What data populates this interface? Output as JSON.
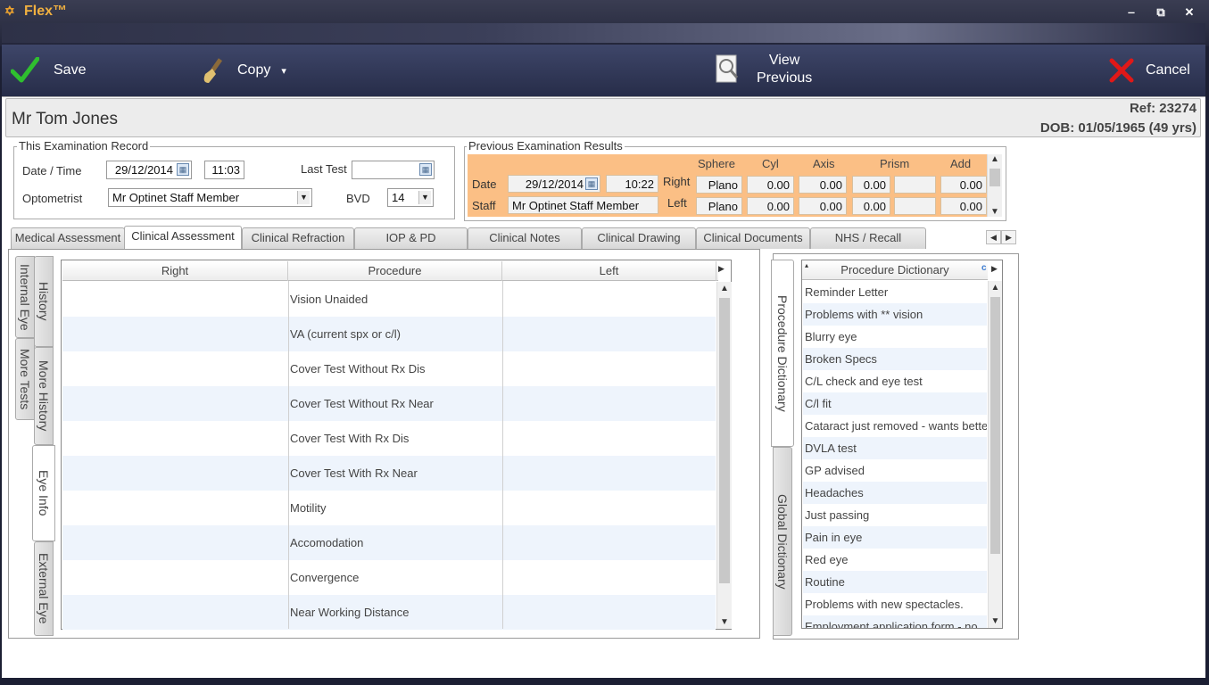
{
  "app": {
    "title": "Flex™",
    "logo": "✡"
  },
  "window": {
    "minimize": "‒",
    "restore": "⧉",
    "close": "✕"
  },
  "toolbar": {
    "save_label": "Save",
    "copy_label": "Copy",
    "copy_arrow": "▾",
    "view_previous_line1": "View",
    "view_previous_line2": "Previous",
    "cancel_label": "Cancel"
  },
  "patient": {
    "name": "Mr Tom Jones",
    "ref": "Ref: 23274",
    "dob": "DOB: 01/05/1965 (49 yrs)"
  },
  "exam": {
    "legend": "This Examination Record",
    "date_time_label": "Date / Time",
    "date": "29/12/2014",
    "time": "11:03",
    "last_test_label": "Last Test",
    "last_test_value": "",
    "optometrist_label": "Optometrist",
    "optometrist_value": "Mr Optinet Staff Member",
    "bvd_label": "BVD",
    "bvd_value": "14"
  },
  "previous": {
    "legend": "Previous Examination Results",
    "headers": {
      "sphere": "Sphere",
      "cyl": "Cyl",
      "axis": "Axis",
      "prism": "Prism",
      "add": "Add"
    },
    "date_label": "Date",
    "date": "29/12/2014",
    "time": "10:22",
    "staff_label": "Staff",
    "staff": "Mr Optinet Staff Member",
    "right_label": "Right",
    "left_label": "Left",
    "right": {
      "sphere": "Plano",
      "cyl": "0.00",
      "axis": "0.00",
      "prism": "0.00",
      "prism2": "",
      "add": "0.00"
    },
    "left": {
      "sphere": "Plano",
      "cyl": "0.00",
      "axis": "0.00",
      "prism": "0.00",
      "prism2": "",
      "add": "0.00"
    }
  },
  "tabs": [
    "Medical Assessment",
    "Clinical Assessment",
    "Clinical Refraction",
    "IOP & PD",
    "Clinical Notes",
    "Clinical Drawing",
    "Clinical Documents",
    "NHS / Recall"
  ],
  "vertical_tabs": {
    "internal_eye": "Internal Eye",
    "history": "History",
    "more_tests": "More Tests",
    "more_history": "More History",
    "eye_info": "Eye Info",
    "external_eye": "External Eye"
  },
  "grid": {
    "headers": {
      "right": "Right",
      "procedure": "Procedure",
      "left": "Left"
    },
    "rows": [
      {
        "right": "",
        "procedure": "Vision Unaided",
        "left": ""
      },
      {
        "right": "",
        "procedure": "VA (current spx or c/l)",
        "left": ""
      },
      {
        "right": "",
        "procedure": "Cover Test Without Rx Dis",
        "left": ""
      },
      {
        "right": "",
        "procedure": "Cover Test Without Rx Near",
        "left": ""
      },
      {
        "right": "",
        "procedure": "Cover Test With Rx Dis",
        "left": ""
      },
      {
        "right": "",
        "procedure": "Cover Test With Rx Near",
        "left": ""
      },
      {
        "right": "",
        "procedure": "Motility",
        "left": ""
      },
      {
        "right": "",
        "procedure": "Accomodation",
        "left": ""
      },
      {
        "right": "",
        "procedure": "Convergence",
        "left": ""
      },
      {
        "right": "",
        "procedure": "Near Working Distance",
        "left": ""
      }
    ]
  },
  "dictionary_tabs": {
    "procedure": "Procedure Dictionary",
    "global": "Global Dictionary"
  },
  "dictionary": {
    "header": "Procedure Dictionary",
    "items": [
      "Reminder Letter",
      "Problems with ** vision",
      "Blurry eye",
      "Broken Specs",
      "C/L check and eye test",
      "C/l fit",
      "Cataract just removed - wants better",
      "DVLA test",
      "GP advised",
      "Headaches",
      "Just passing",
      "Pain in eye",
      "Red eye",
      "Routine",
      "Problems with new spectacles.",
      "Employment application form - no"
    ]
  }
}
